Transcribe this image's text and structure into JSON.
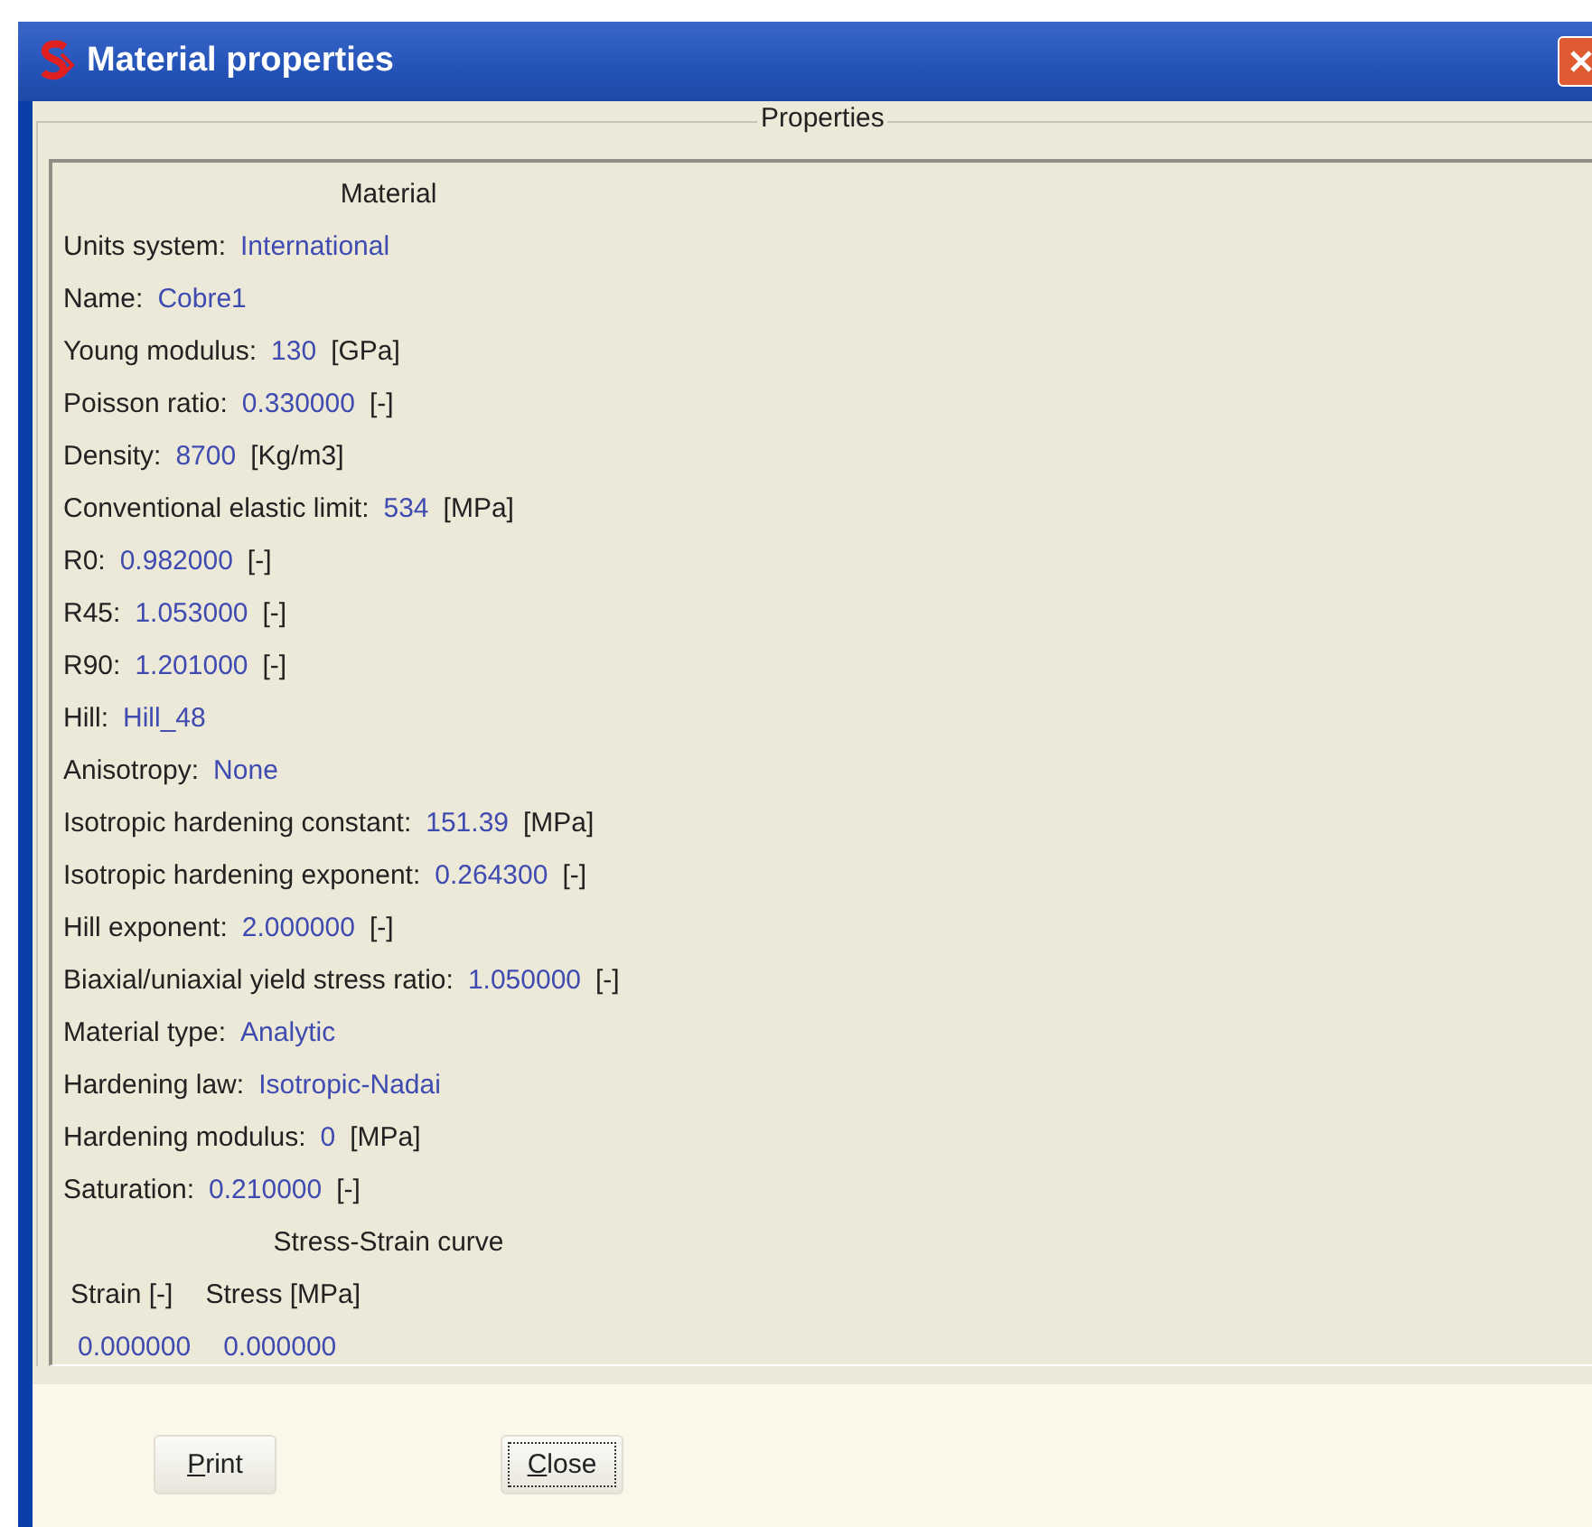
{
  "window": {
    "title": "Material properties"
  },
  "group": {
    "title": "Properties"
  },
  "material_heading": "Material",
  "properties": [
    {
      "label": "Units system:",
      "value": "International"
    },
    {
      "label": "Name:",
      "value": "Cobre1"
    },
    {
      "label": "Young modulus:",
      "value": "130",
      "unit": "[GPa]"
    },
    {
      "label": "Poisson ratio:",
      "value": "0.330000",
      "unit": "[-]"
    },
    {
      "label": "Density:",
      "value": "8700",
      "unit": "[Kg/m3]"
    },
    {
      "label": "Conventional elastic limit:",
      "value": "534",
      "unit": "[MPa]"
    },
    {
      "label": "R0:",
      "value": "0.982000",
      "unit": "[-]"
    },
    {
      "label": "R45:",
      "value": "1.053000",
      "unit": "[-]"
    },
    {
      "label": "R90:",
      "value": "1.201000",
      "unit": "[-]"
    },
    {
      "label": "Hill:",
      "value": "Hill_48"
    },
    {
      "label": "Anisotropy:",
      "value": "None"
    },
    {
      "label": "Isotropic hardening constant:",
      "value": "151.39",
      "unit": "[MPa]"
    },
    {
      "label": "Isotropic hardening exponent:",
      "value": "0.264300",
      "unit": "[-]"
    },
    {
      "label": "Hill exponent:",
      "value": "2.000000",
      "unit": "[-]"
    },
    {
      "label": "Biaxial/uniaxial yield stress ratio:",
      "value": "1.050000",
      "unit": "[-]"
    },
    {
      "label": "Material type:",
      "value": "Analytic"
    },
    {
      "label": "Hardening law:",
      "value": "Isotropic-Nadai"
    },
    {
      "label": "Hardening modulus:",
      "value": "0",
      "unit": "[MPa]"
    },
    {
      "label": "Saturation:",
      "value": "0.210000",
      "unit": "[-]"
    }
  ],
  "curve": {
    "heading": "Stress-Strain curve",
    "columns": [
      "Strain [-]",
      "Stress [MPa]"
    ],
    "rows": [
      [
        "0.000000",
        "0.000000"
      ]
    ]
  },
  "buttons": [
    {
      "label": "Print",
      "focused": false
    },
    {
      "label": "Close",
      "focused": true
    }
  ]
}
